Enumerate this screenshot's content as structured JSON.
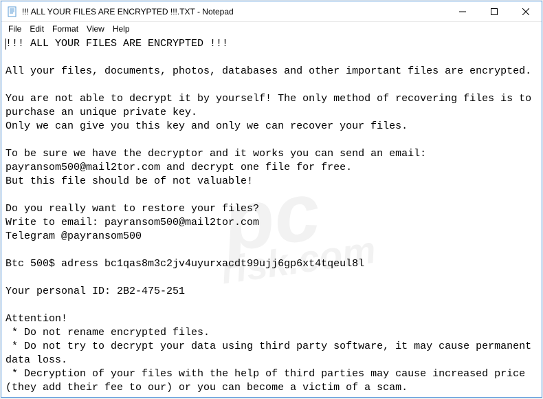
{
  "window": {
    "title": "!!! ALL YOUR FILES ARE ENCRYPTED !!!.TXT - Notepad"
  },
  "menu": {
    "file": "File",
    "edit": "Edit",
    "format": "Format",
    "view": "View",
    "help": "Help"
  },
  "body": {
    "text": "!!! ALL YOUR FILES ARE ENCRYPTED !!!\n\nAll your files, documents, photos, databases and other important files are encrypted.\n\nYou are not able to decrypt it by yourself! The only method of recovering files is to purchase an unique private key.\nOnly we can give you this key and only we can recover your files.\n\nTo be sure we have the decryptor and it works you can send an email: payransom500@mail2tor.com and decrypt one file for free.\nBut this file should be of not valuable!\n\nDo you really want to restore your files?\nWrite to email: payransom500@mail2tor.com\nTelegram @payransom500\n\nBtc 500$ adress bc1qas8m3c2jv4uyurxacdt99ujj6gp6xt4tqeul8l\n\nYour personal ID: 2B2-475-251\n\nAttention!\n * Do not rename encrypted files.\n * Do not try to decrypt your data using third party software, it may cause permanent data loss.\n * Decryption of your files with the help of third parties may cause increased price (they add their fee to our) or you can become a victim of a scam."
  },
  "watermark": {
    "main": "pc",
    "sub": "risk.com"
  }
}
